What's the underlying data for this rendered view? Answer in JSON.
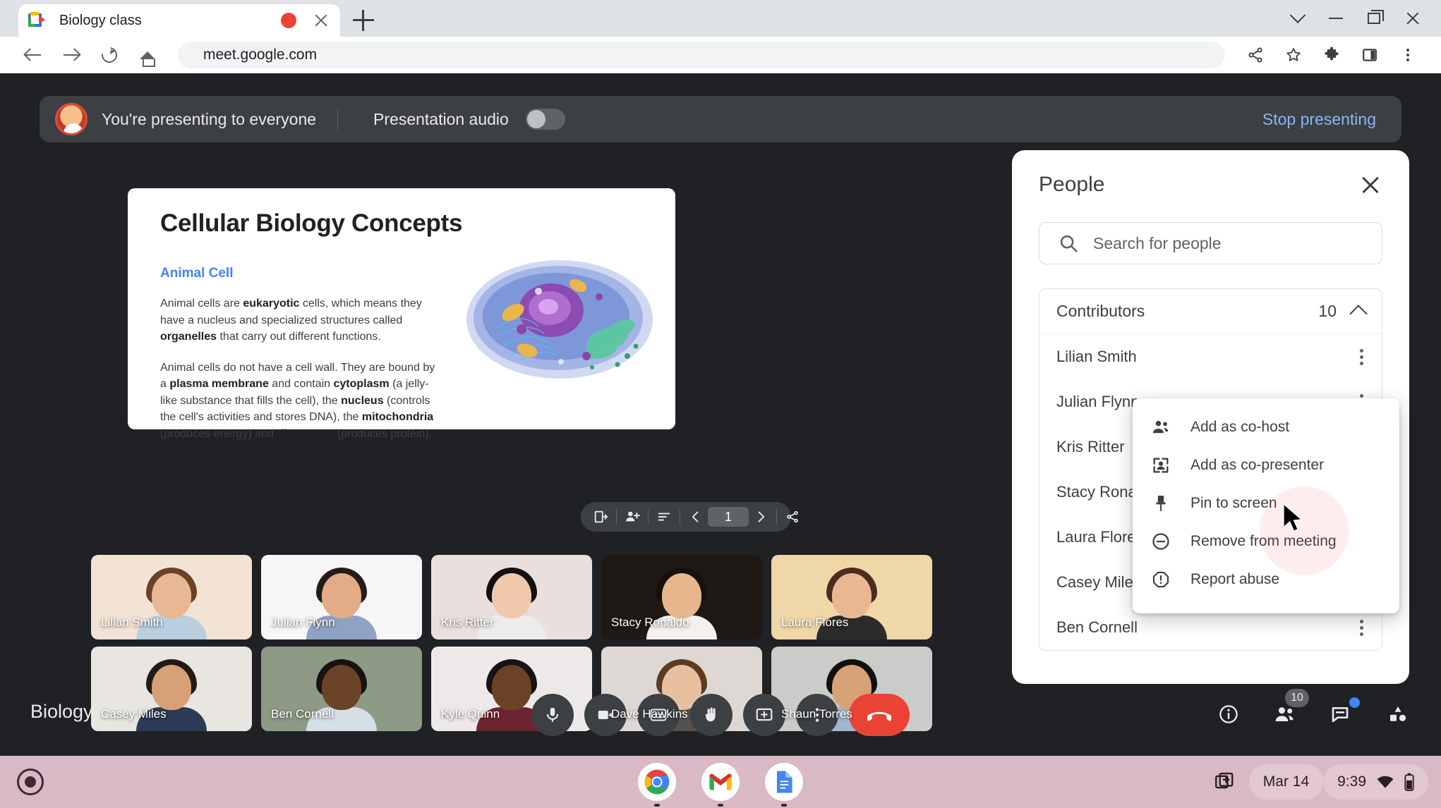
{
  "browser": {
    "tab_title": "Biology class",
    "favicon": "google-meet-icon",
    "recording_indicator": "record-dot",
    "url": "meet.google.com",
    "new_tab_label": "+",
    "toolbar_icons": [
      "share-icon",
      "bookmark-star-icon",
      "extensions-puzzle-icon",
      "side-panel-icon",
      "chrome-menu-icon"
    ],
    "nav_icons": [
      "back-arrow-icon",
      "forward-arrow-icon",
      "reload-icon",
      "home-icon"
    ],
    "window_icons": [
      "chevron-down-icon",
      "minimize-icon",
      "maximize-icon",
      "close-icon"
    ]
  },
  "presenting_bar": {
    "status": "You're presenting to everyone",
    "audio_label": "Presentation audio",
    "audio_toggle_on": false,
    "stop_label": "Stop presenting",
    "stop_color": "#8ab4f8"
  },
  "slide": {
    "title": "Cellular Biology Concepts",
    "subtitle": "Animal Cell",
    "subtitle_color": "#4285f4",
    "paragraph_1": "Animal cells are eukaryotic cells, which means they have a nucleus and specialized structures called organelles that carry out different functions.",
    "paragraph_2": "Animal cells do not have a cell wall. They are bound by a plasma membrane and contain cytoplasm (a jelly-like substance that fills the cell), the nucleus (controls the cell's activities and stores DNA), the mitochondria (produces energy) and ribosomes (produces protein).",
    "image_alt": "animal-cell-diagram",
    "toolbar": {
      "page_number": "1",
      "icons": [
        "present-to-window-icon",
        "add-person-icon",
        "speaker-notes-icon",
        "previous-slide-icon",
        "next-slide-icon",
        "share-slide-icon"
      ]
    }
  },
  "tiles": [
    {
      "name": "Lilian Smith",
      "bg": "#f2e3d5",
      "hair": "#6b4226",
      "skin": "#e8b894",
      "shirt": "#b9cede"
    },
    {
      "name": "Julian Flynn",
      "bg": "#f6f6f6",
      "hair": "#241c17",
      "skin": "#e3ab86",
      "shirt": "#8ea3c4"
    },
    {
      "name": "Kris Ritter",
      "bg": "#e9e0de",
      "hair": "#14100f",
      "skin": "#f0c9ad",
      "shirt": "#ececec"
    },
    {
      "name": "Stacy Ronaldo",
      "bg": "#1f1915",
      "hair": "#17110d",
      "skin": "#e8b68d",
      "shirt": "#f4f1ec"
    },
    {
      "name": "Laura Flores",
      "bg": "#f0d7a8",
      "hair": "#4a2d1d",
      "skin": "#eab793",
      "shirt": "#2b2b2b"
    },
    {
      "name": "Casey Miles",
      "bg": "#e9e6e1",
      "hair": "#241a14",
      "skin": "#d8a077",
      "shirt": "#2b3a55"
    },
    {
      "name": "Ben Cornell",
      "bg": "#8c9a86",
      "hair": "#181210",
      "skin": "#6b4327",
      "shirt": "#d7dfe6"
    },
    {
      "name": "Kyle Quinn",
      "bg": "#eee9e9",
      "hair": "#171213",
      "skin": "#6a4327",
      "shirt": "#6e2430"
    },
    {
      "name": "Dave Hawkins",
      "bg": "#ddd8d4",
      "hair": "#5c3b21",
      "skin": "#e8c0a0",
      "shirt": "#55524e"
    },
    {
      "name": "Shaun Torres",
      "bg": "#c9ccc8",
      "hair": "#12100f",
      "skin": "#d6a276",
      "shirt": "#9fb6cc"
    }
  ],
  "meet_bottom": {
    "meeting_name": "Biology class",
    "controls": [
      "microphone-icon",
      "camera-icon",
      "captions-icon",
      "raise-hand-icon",
      "present-screen-icon",
      "more-options-icon",
      "leave-call-icon"
    ],
    "right_controls": [
      {
        "name": "meeting-details-icon",
        "badge": null
      },
      {
        "name": "people-icon",
        "badge": "10"
      },
      {
        "name": "chat-icon",
        "badge": null,
        "dot": true
      },
      {
        "name": "activities-icon",
        "badge": null
      }
    ]
  },
  "people_panel": {
    "title": "People",
    "close_icon": "close-icon",
    "search_placeholder": "Search for people",
    "search_value": "",
    "search_icon": "search-icon",
    "section": {
      "label": "Contributors",
      "count": "10",
      "collapse_icon": "chevron-up-icon"
    },
    "participants": [
      {
        "name": "Lilian Smith"
      },
      {
        "name": "Julian Flynn"
      },
      {
        "name": "Kris Ritter"
      },
      {
        "name": "Stacy Ronaldo"
      },
      {
        "name": "Laura Flores"
      },
      {
        "name": "Casey Miles"
      },
      {
        "name": "Ben Cornell"
      }
    ]
  },
  "context_menu": {
    "items": [
      {
        "label": "Add as co-host",
        "icon": "people-group-icon"
      },
      {
        "label": "Add as co-presenter",
        "icon": "present-person-icon"
      },
      {
        "label": "Pin to screen",
        "icon": "pin-icon"
      },
      {
        "label": "Remove from meeting",
        "icon": "minus-circle-icon"
      },
      {
        "label": "Report abuse",
        "icon": "warning-octagon-icon"
      }
    ]
  },
  "shelf": {
    "launcher_icon": "launcher-icon",
    "apps": [
      "chrome-icon",
      "gmail-icon",
      "docs-icon"
    ],
    "screen_capture_icon": "screen-capture-icon",
    "date": "Mar 14",
    "time": "9:39",
    "status_icons": [
      "wifi-icon",
      "battery-icon"
    ],
    "background_color": "#d9b9c6"
  }
}
